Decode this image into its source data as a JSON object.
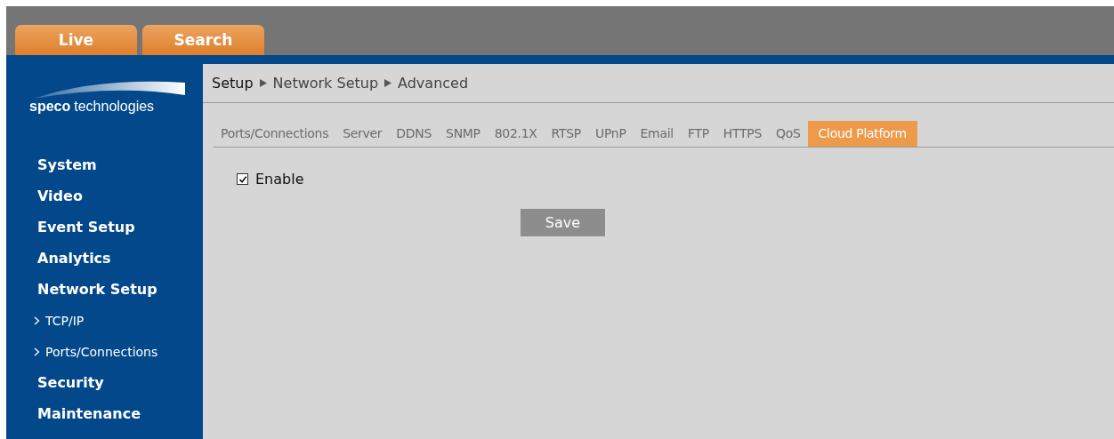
{
  "top_tabs": [
    {
      "label": "Live"
    },
    {
      "label": "Search"
    }
  ],
  "logo": {
    "brand": "speco",
    "rest": "technologies"
  },
  "sidebar": {
    "items": [
      {
        "label": "System"
      },
      {
        "label": "Video"
      },
      {
        "label": "Event Setup"
      },
      {
        "label": "Analytics"
      },
      {
        "label": "Network Setup",
        "children": [
          {
            "label": "TCP/IP"
          },
          {
            "label": "Ports/Connections"
          }
        ]
      },
      {
        "label": "Security"
      },
      {
        "label": "Maintenance"
      }
    ]
  },
  "breadcrumb": [
    "Setup",
    "Network Setup",
    "Advanced"
  ],
  "tabs": [
    {
      "label": "Ports/Connections",
      "selected": false
    },
    {
      "label": "Server",
      "selected": false
    },
    {
      "label": "DDNS",
      "selected": false
    },
    {
      "label": "SNMP",
      "selected": false
    },
    {
      "label": "802.1X",
      "selected": false
    },
    {
      "label": "RTSP",
      "selected": false
    },
    {
      "label": "UPnP",
      "selected": false
    },
    {
      "label": "Email",
      "selected": false
    },
    {
      "label": "FTP",
      "selected": false
    },
    {
      "label": "HTTPS",
      "selected": false
    },
    {
      "label": "QoS",
      "selected": false
    },
    {
      "label": "Cloud Platform",
      "selected": true
    }
  ],
  "enable": {
    "label": "Enable",
    "checked": true
  },
  "save_button": "Save"
}
